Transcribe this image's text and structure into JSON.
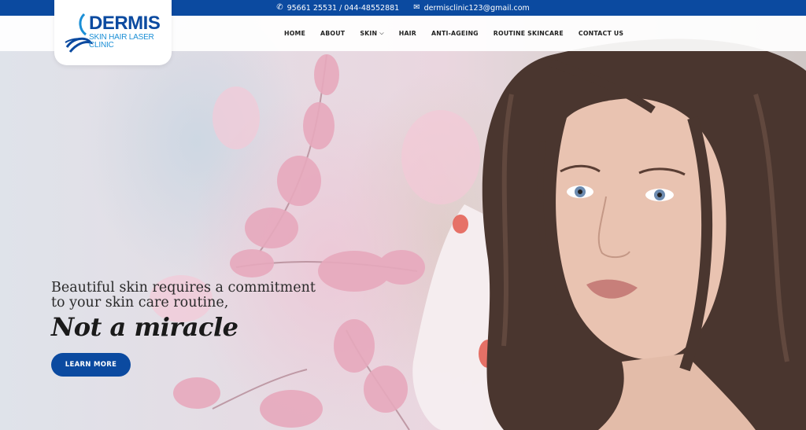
{
  "topbar": {
    "phone": "95661 25531 / 044-48552881",
    "email": "dermisclinic123@gmail.com",
    "phone_icon": "phone-icon",
    "email_icon": "envelope-icon"
  },
  "logo": {
    "name": "DERMIS",
    "tagline": "SKIN HAIR LASER CLINIC"
  },
  "nav": {
    "items": [
      {
        "label": "HOME"
      },
      {
        "label": "ABOUT"
      },
      {
        "label": "SKIN",
        "has_dropdown": true
      },
      {
        "label": "HAIR"
      },
      {
        "label": "ANTI-AGEING"
      },
      {
        "label": "ROUTINE SKINCARE"
      },
      {
        "label": "CONTACT US"
      }
    ]
  },
  "hero": {
    "tagline": "Beautiful skin requires a commitment to your skin care routine,",
    "headline": "Not a miracle",
    "cta_label": "LEARN MORE"
  },
  "colors": {
    "brand_blue": "#0b4aa0",
    "accent_light_blue": "#1b8fd6"
  }
}
